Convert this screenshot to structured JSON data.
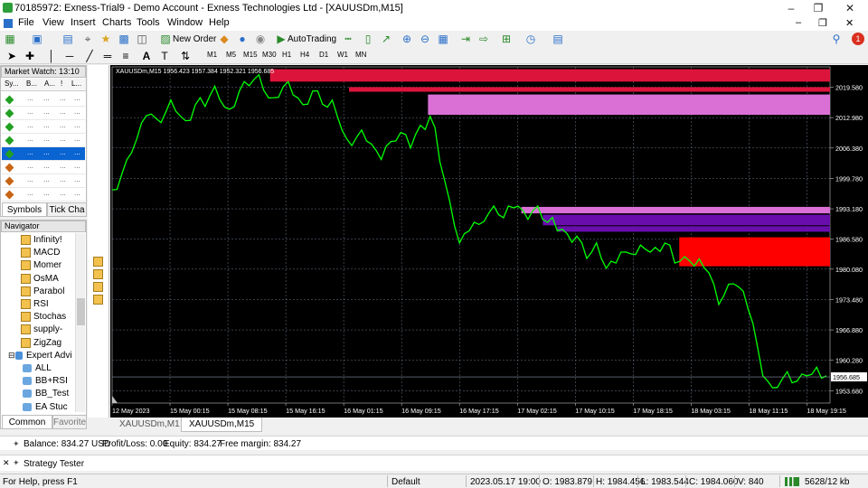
{
  "window": {
    "title": "70185972: Exness-Trial9 - Demo Account - Exness Technologies Ltd - [XAUUSDm,M15]"
  },
  "menu": [
    "File",
    "View",
    "Insert",
    "Charts",
    "Tools",
    "Window",
    "Help"
  ],
  "toolbar": {
    "new_order": "New Order",
    "autotrading": "AutoTrading",
    "notification_count": "1",
    "timeframes": [
      "M1",
      "M5",
      "M15",
      "M30",
      "H1",
      "H4",
      "D1",
      "W1",
      "MN"
    ]
  },
  "market_watch": {
    "title": "Market Watch: 13:10",
    "columns": [
      "Sy...",
      "B...",
      "A...",
      "!",
      "L..."
    ],
    "row_colors": [
      "#22a022",
      "#22a022",
      "#22a022",
      "#22a022",
      "#22a022",
      "#c86414",
      "#c86414",
      "#c86414",
      "#22a022"
    ],
    "cell_text": "..."
  },
  "panel_tabs": {
    "symbols": "Symbols",
    "tick_chart": "Tick Cha"
  },
  "navigator": {
    "title": "Navigator",
    "indicators": [
      "Infinity!",
      "MACD",
      "Momer",
      "OsMA",
      "Parabol",
      "RSI",
      "Stochas",
      "supply-",
      "ZigZag"
    ],
    "expert_folder": "Expert Advi",
    "experts": [
      "ALL",
      "BB+RSI",
      "BB_Test",
      "EA Stuc"
    ],
    "tabs": [
      "Common",
      "Favorite"
    ]
  },
  "chart": {
    "header": "XAUUSDm,M15  1956.423 1957.384 1952.321 1956.685",
    "current_price": "1956.685",
    "background": "#000000",
    "line_color": "#00ff00",
    "x_labels": [
      "12 May 2023",
      "15 May 00:15",
      "15 May 08:15",
      "15 May 16:15",
      "16 May 01:15",
      "16 May 09:15",
      "16 May 17:15",
      "17 May 02:15",
      "17 May 10:15",
      "17 May 18:15",
      "18 May 03:15",
      "18 May 11:15",
      "18 May 19:15"
    ],
    "y_labels": [
      "2019.580",
      "2012.980",
      "2006.380",
      "1999.780",
      "1993.180",
      "1986.580",
      "1980.080",
      "1973.480",
      "1966.880",
      "1960.280",
      "1953.680"
    ],
    "zones": [
      {
        "color": "#dc143c",
        "top": 2023.5,
        "bottom": 2020.8,
        "start": 0.22
      },
      {
        "color": "#dc143c",
        "top": 2019.6,
        "bottom": 2018.6,
        "start": 0.33
      },
      {
        "color": "#da70d6",
        "top": 2018.0,
        "bottom": 2013.6,
        "start": 0.44
      },
      {
        "color": "#da70d6",
        "top": 1993.6,
        "bottom": 1992.2,
        "start": 0.57
      },
      {
        "color": "#6a0dad",
        "top": 1991.9,
        "bottom": 1989.6,
        "start": 0.6
      },
      {
        "color": "#6a0dad",
        "top": 1989.4,
        "bottom": 1988.2,
        "start": 0.62
      },
      {
        "color": "#ff0000",
        "top": 1987.0,
        "bottom": 1980.7,
        "start": 0.79
      }
    ],
    "price_path": [
      1996.5,
      1998.0,
      2000.5,
      2003.0,
      2006.0,
      2008.0,
      2011.0,
      2014.0,
      2013.5,
      2012.0,
      2012.5,
      2014.0,
      2016.0,
      2015.0,
      2013.0,
      2011.5,
      2013.0,
      2015.5,
      2016.5,
      2016.0,
      2017.5,
      2019.0,
      2017.5,
      2015.0,
      2014.0,
      2016.0,
      2018.5,
      2020.0,
      2020.5,
      2021.0,
      2021.5,
      2019.5,
      2017.0,
      2016.5,
      2018.0,
      2019.5,
      2020.0,
      2018.5,
      2017.0,
      2015.0,
      2016.5,
      2018.5,
      2018.0,
      2016.5,
      2015.0,
      2016.0,
      2014.0,
      2010.0,
      2007.5,
      2007.5,
      2008.5,
      2009.5,
      2008.5,
      2007.0,
      2005.0,
      2004.5,
      2006.5,
      2007.0,
      2008.5,
      2009.5,
      2008.5,
      2007.0,
      2009.0,
      2010.5,
      2011.0,
      2013.0,
      2010.0,
      2004.0,
      1999.0,
      1994.0,
      1990.0,
      1985.5,
      1987.0,
      1989.0,
      1990.0,
      1989.0,
      1991.0,
      1992.0,
      1993.0,
      1992.5,
      1991.0,
      1993.0,
      1994.0,
      1993.5,
      1992.0,
      1991.5,
      1992.5,
      1993.0,
      1991.5,
      1990.0,
      1990.5,
      1989.0,
      1988.5,
      1987.0,
      1986.5,
      1987.0,
      1985.0,
      1983.0,
      1983.5,
      1985.0,
      1983.0,
      1980.0,
      1981.0,
      1982.0,
      1983.5,
      1983.0,
      1984.0,
      1983.0,
      1984.5,
      1985.0,
      1983.5,
      1984.0,
      1984.5,
      1985.5,
      1984.5,
      1982.0,
      1981.5,
      1982.0,
      1982.5,
      1980.5,
      1981.5,
      1981.0,
      1979.0,
      1976.0,
      1973.0,
      1974.0,
      1976.0,
      1977.5,
      1976.0,
      1974.5,
      1972.0,
      1968.0,
      1962.0,
      1957.5,
      1955.5,
      1953.5,
      1955.0,
      1956.0,
      1957.0,
      1956.0,
      1955.5,
      1956.5,
      1957.5,
      1957.0,
      1958.0,
      1957.0,
      1956.685
    ]
  },
  "chart_tabs": [
    "XAUUSDm,M1",
    "XAUUSDm,M15"
  ],
  "account": {
    "balance_label": "Balance: 834.27 USD",
    "profit_label": "Profit/Loss: 0.00",
    "equity_label": "Equity: 834.27",
    "margin_label": "Free margin: 834.27"
  },
  "strategy_tester": "Strategy Tester",
  "statusbar": {
    "help": "For Help, press F1",
    "profile": "Default",
    "datetime": "2023.05.17 19:00",
    "open": "O: 1983.879",
    "high": "H: 1984.456",
    "low": "L: 1983.544",
    "close": "C: 1984.060",
    "volume": "V: 840",
    "traffic": "5628/12 kb"
  }
}
